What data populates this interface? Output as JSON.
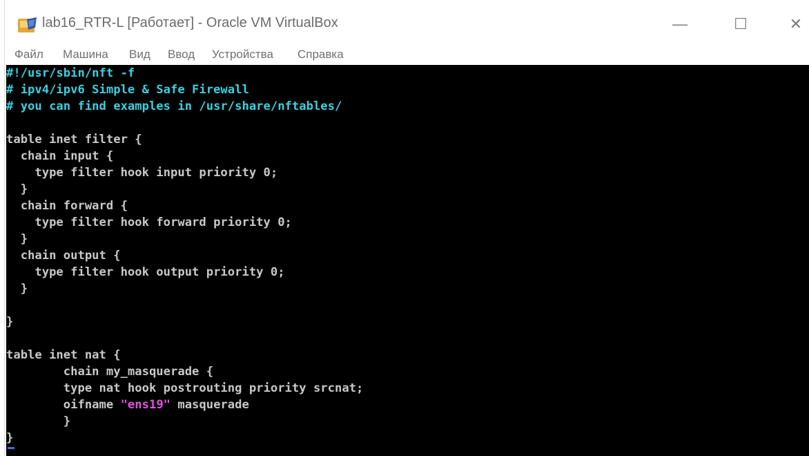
{
  "window": {
    "title": "lab16_RTR-L [Работает] - Oracle VM VirtualBox",
    "app_icon": "virtualbox-icon",
    "controls": {
      "minimize": "—",
      "maximize": "☐",
      "close": "✕"
    }
  },
  "menu": {
    "items": [
      "Файл",
      "Машина",
      "Вид",
      "Ввод",
      "Устройства",
      "Справка"
    ]
  },
  "console": {
    "colors": {
      "comment": "#39d0e0",
      "code": "#c8c8c8",
      "string": "#e64fe6",
      "background": "#000000"
    },
    "lines": {
      "l1": "#!/usr/sbin/nft -f",
      "l2": "# ipv4/ipv6 Simple & Safe Firewall",
      "l3": "# you can find examples in /usr/share/nftables/",
      "l5": "table inet filter {",
      "l6": "  chain input {",
      "l7": "    type filter hook input priority 0;",
      "l8": "  }",
      "l9": "  chain forward {",
      "l10": "    type filter hook forward priority 0;",
      "l11": "  }",
      "l12": "  chain output {",
      "l13": "    type filter hook output priority 0;",
      "l14": "  }",
      "l16": "}",
      "l18": "table inet nat {",
      "l19": "        chain my_masquerade {",
      "l20": "        type nat hook postrouting priority srcnat;",
      "l21a": "        oifname ",
      "l21b": "\"ens19\"",
      "l21c": " masquerade",
      "l22": "        }",
      "l23": "}"
    }
  }
}
